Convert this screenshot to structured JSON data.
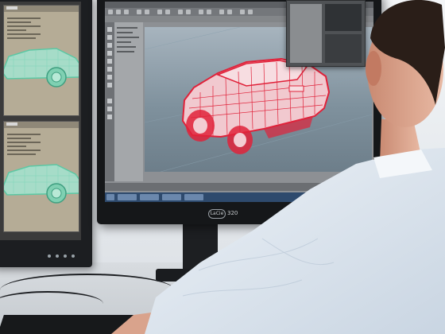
{
  "monitor_brand": "LaCie",
  "monitor_model": "320",
  "colors": {
    "wireframe": "#e0223a",
    "panel_wireframe": "#5cc8a4",
    "shirt": "#dfe8f2"
  },
  "icons": [
    "app-toolbar-icon",
    "taskbar-button"
  ]
}
